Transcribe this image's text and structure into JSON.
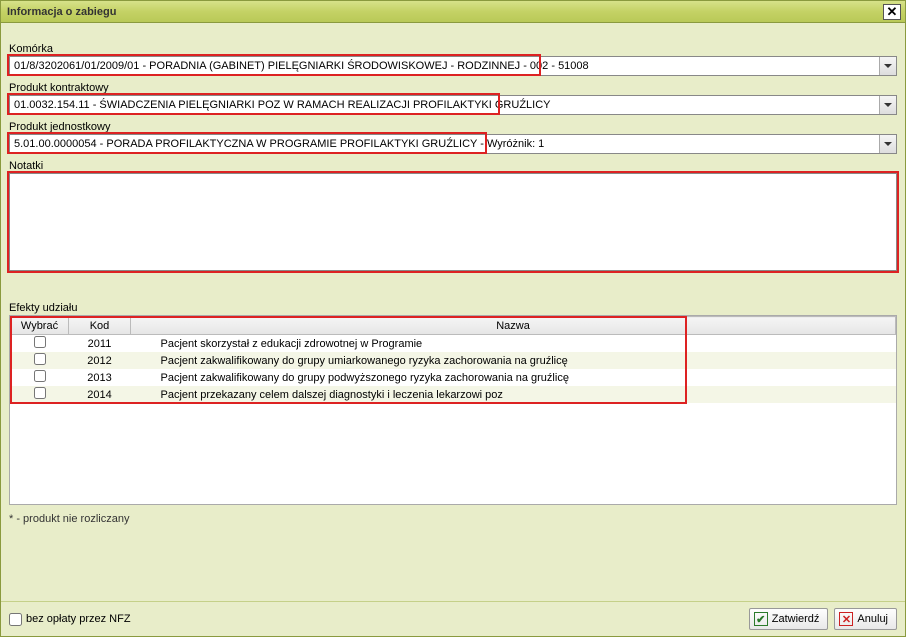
{
  "window": {
    "title": "Informacja o zabiegu"
  },
  "labels": {
    "komorka": "Komórka",
    "produkt_kontraktowy": "Produkt kontraktowy",
    "produkt_jednostkowy": "Produkt jednostkowy",
    "notatki": "Notatki",
    "efekty": "Efekty udziału",
    "footnote": "* - produkt nie rozliczany",
    "bez_oplaty": "bez opłaty przez NFZ"
  },
  "selects": {
    "komorka": "01/8/3202061/01/2009/01 - PORADNIA (GABINET) PIELĘGNIARKI ŚRODOWISKOWEJ - RODZINNEJ - 002 - 51008",
    "produkt_kontraktowy": "01.0032.154.11 - ŚWIADCZENIA PIELĘGNIARKI POZ W RAMACH REALIZACJI PROFILAKTYKI  GRUŹLICY",
    "produkt_jednostkowy": "5.01.00.0000054 - PORADA PROFILAKTYCZNA W PROGRAMIE PROFILAKTYKI GRUŹLICY - Wyróżnik: 1"
  },
  "notes": "",
  "table": {
    "headers": {
      "wybrac": "Wybrać",
      "kod": "Kod",
      "nazwa": "Nazwa"
    },
    "rows": [
      {
        "checked": false,
        "kod": "2011",
        "nazwa": "Pacjent skorzystał z edukacji zdrowotnej w Programie"
      },
      {
        "checked": false,
        "kod": "2012",
        "nazwa": "Pacjent zakwalifikowany do grupy umiarkowanego ryzyka zachorowania na gruźlicę"
      },
      {
        "checked": false,
        "kod": "2013",
        "nazwa": "Pacjent zakwalifikowany do grupy podwyższonego ryzyka zachorowania na gruźlicę"
      },
      {
        "checked": false,
        "kod": "2014",
        "nazwa": "Pacjent przekazany celem dalszej diagnostyki i leczenia lekarzowi poz"
      }
    ]
  },
  "buttons": {
    "confirm": "Zatwierdź",
    "cancel": "Anuluj"
  },
  "bez_oplaty_checked": false
}
